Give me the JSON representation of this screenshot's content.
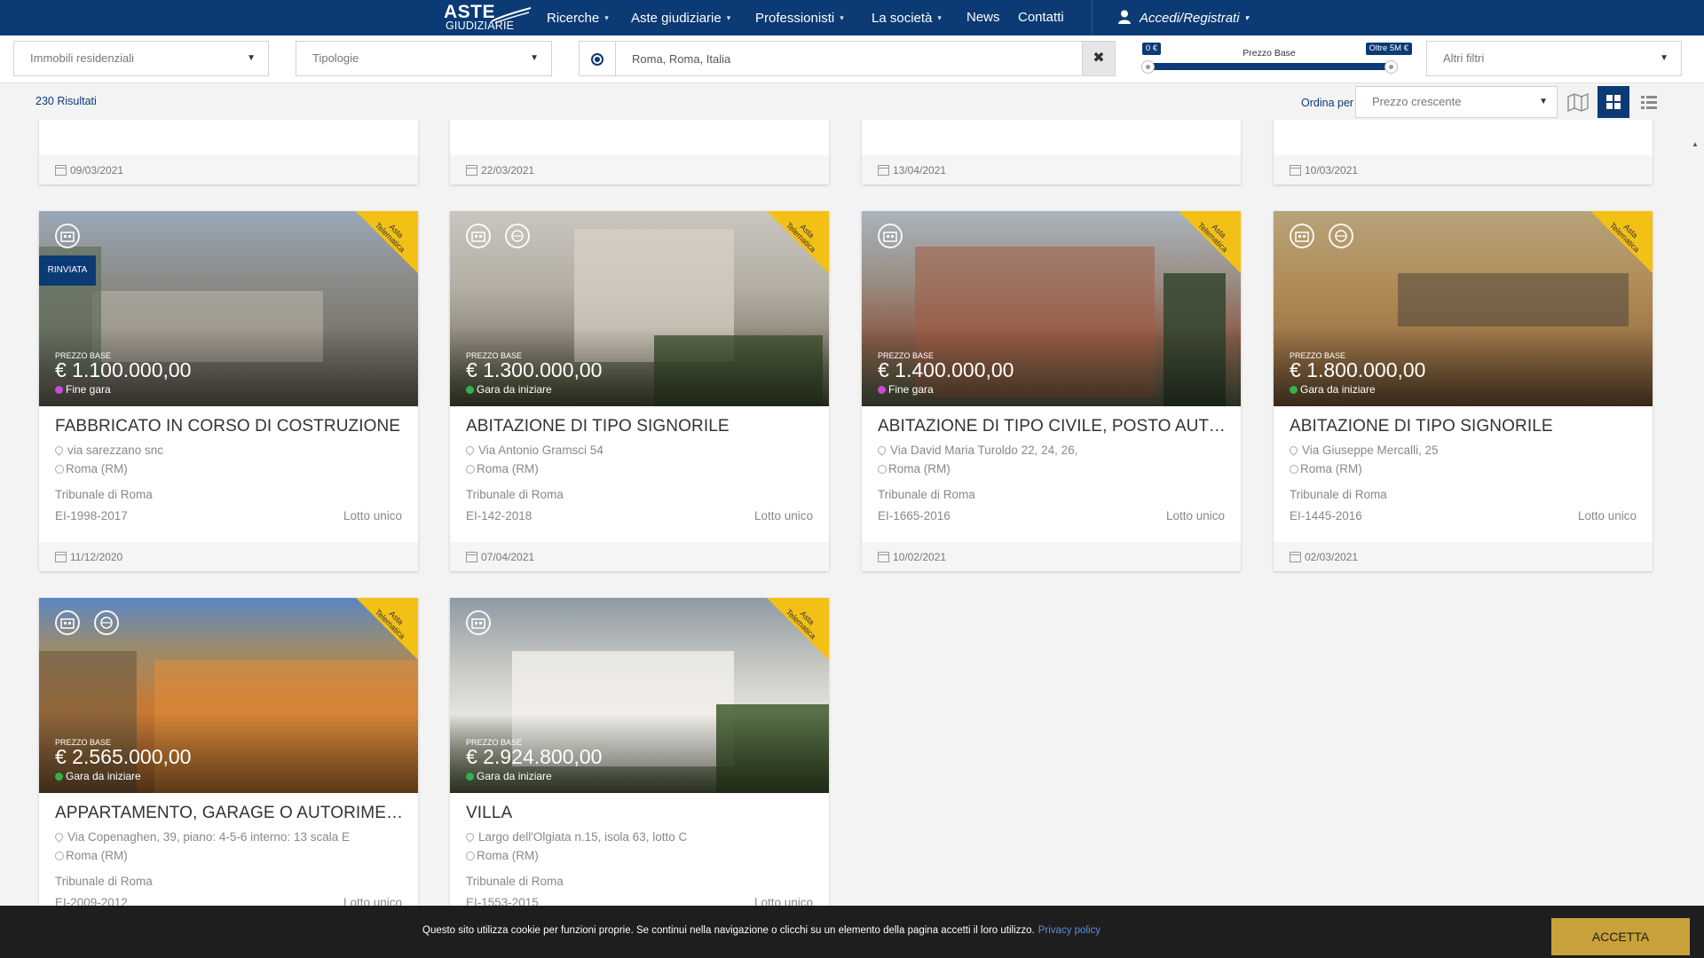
{
  "nav": {
    "logo_line1": "ASTE",
    "logo_line2": "GIUDIZIARIE",
    "items": [
      {
        "label": "Ricerche"
      },
      {
        "label": "Aste giudiziarie"
      },
      {
        "label": "Professionisti"
      },
      {
        "label": "La società"
      },
      {
        "label": "News"
      },
      {
        "label": "Contatti"
      }
    ],
    "login_label": "Accedi/Registrati",
    "caret": "▾"
  },
  "filters": {
    "category": "Immobili residenziali",
    "typology": "Tipologie",
    "location_value": "Roma, Roma, Italia",
    "clear_symbol": "✖",
    "price_label": "Prezzo Base",
    "price_min": "0 €",
    "price_max": "Oltre 5M €",
    "price_range_fraction": [
      0,
      1
    ],
    "more_filters": "Altri filtri"
  },
  "results": {
    "count_label": "230 Risultati",
    "order_label": "Ordina per",
    "order_value": "Prezzo crescente",
    "views": [
      "map-view",
      "grid-view",
      "list-view"
    ],
    "active_view": "grid-view"
  },
  "stub_cards": [
    {
      "date": "09/03/2021"
    },
    {
      "date": "22/03/2021"
    },
    {
      "date": "13/04/2021"
    },
    {
      "date": "10/03/2021"
    }
  ],
  "cards": [
    {
      "ribbon": "Asta Telematica",
      "badge": "RINVIATA",
      "price_label": "PREZZO BASE",
      "price": "€ 1.100.000,00",
      "status": "Fine gara",
      "status_color": "#c84bd6",
      "title": "FABBRICATO IN CORSO DI COSTRUZIONE",
      "address": "via sarezzano snc",
      "city": "Roma (RM)",
      "court": "Tribunale di Roma",
      "procedure": "EI-1998-2017",
      "lot": "Lotto unico",
      "date": "11/12/2020",
      "icons": [
        "building-icon"
      ]
    },
    {
      "ribbon": "Asta Telematica",
      "price_label": "PREZZO BASE",
      "price": "€ 1.300.000,00",
      "status": "Gara da iniziare",
      "status_color": "#2fb34a",
      "title": "ABITAZIONE DI TIPO SIGNORILE",
      "address": "Via Antonio Gramsci 54",
      "city": "Roma (RM)",
      "court": "Tribunale di Roma",
      "procedure": "EI-142-2018",
      "lot": "Lotto unico",
      "date": "07/04/2021",
      "icons": [
        "building-icon",
        "360-tour-icon"
      ]
    },
    {
      "ribbon": "Asta Telematica",
      "price_label": "PREZZO BASE",
      "price": "€ 1.400.000,00",
      "status": "Fine gara",
      "status_color": "#c84bd6",
      "title": "ABITAZIONE DI TIPO CIVILE, POSTO AUTO SCOPERTO",
      "address": "Via David Maria Turoldo 22, 24, 26,",
      "city": "Roma (RM)",
      "court": "Tribunale di Roma",
      "procedure": "EI-1665-2016",
      "lot": "Lotto unico",
      "date": "10/02/2021",
      "icons": [
        "building-icon"
      ]
    },
    {
      "ribbon": "Asta Telematica",
      "price_label": "PREZZO BASE",
      "price": "€ 1.800.000,00",
      "status": "Gara da iniziare",
      "status_color": "#2fb34a",
      "title": "ABITAZIONE DI TIPO SIGNORILE",
      "address": "Via Giuseppe Mercalli, 25",
      "city": "Roma (RM)",
      "court": "Tribunale di Roma",
      "procedure": "EI-1445-2016",
      "lot": "Lotto unico",
      "date": "02/03/2021",
      "icons": [
        "building-icon",
        "360-tour-icon"
      ]
    },
    {
      "ribbon": "Asta Telematica",
      "price_label": "PREZZO BASE",
      "price": "€ 2.565.000,00",
      "status": "Gara da iniziare",
      "status_color": "#2fb34a",
      "title": "APPARTAMENTO, GARAGE O AUTORIMESSA",
      "address": "Via Copenaghen, 39, piano: 4-5-6 interno: 13 scala E",
      "city": "Roma (RM)",
      "court": "Tribunale di Roma",
      "procedure": "EI-2009-2012",
      "lot": "Lotto unico",
      "date": "",
      "icons": [
        "building-icon",
        "360-tour-icon"
      ]
    },
    {
      "ribbon": "Asta Telematica",
      "price_label": "PREZZO BASE",
      "price": "€ 2.924.800,00",
      "status": "Gara da iniziare",
      "status_color": "#2fb34a",
      "title": "VILLA",
      "address": "Largo dell'Olgiata n.15, isola 63, lotto C",
      "city": "Roma (RM)",
      "court": "Tribunale di Roma",
      "procedure": "EI-1553-2015",
      "lot": "Lotto unico",
      "date": "",
      "icons": [
        "building-icon"
      ]
    }
  ],
  "cookie": {
    "text": "Questo sito utilizza cookie per funzioni proprie. Se continui nella navigazione o clicchi su un elemento della pagina accetti il loro utilizzo.",
    "link": "Privacy policy",
    "accept": "ACCETTA"
  },
  "colors": {
    "brand": "#0b3a74",
    "ribbon": "#f3c016",
    "accept": "#c9a13a"
  }
}
